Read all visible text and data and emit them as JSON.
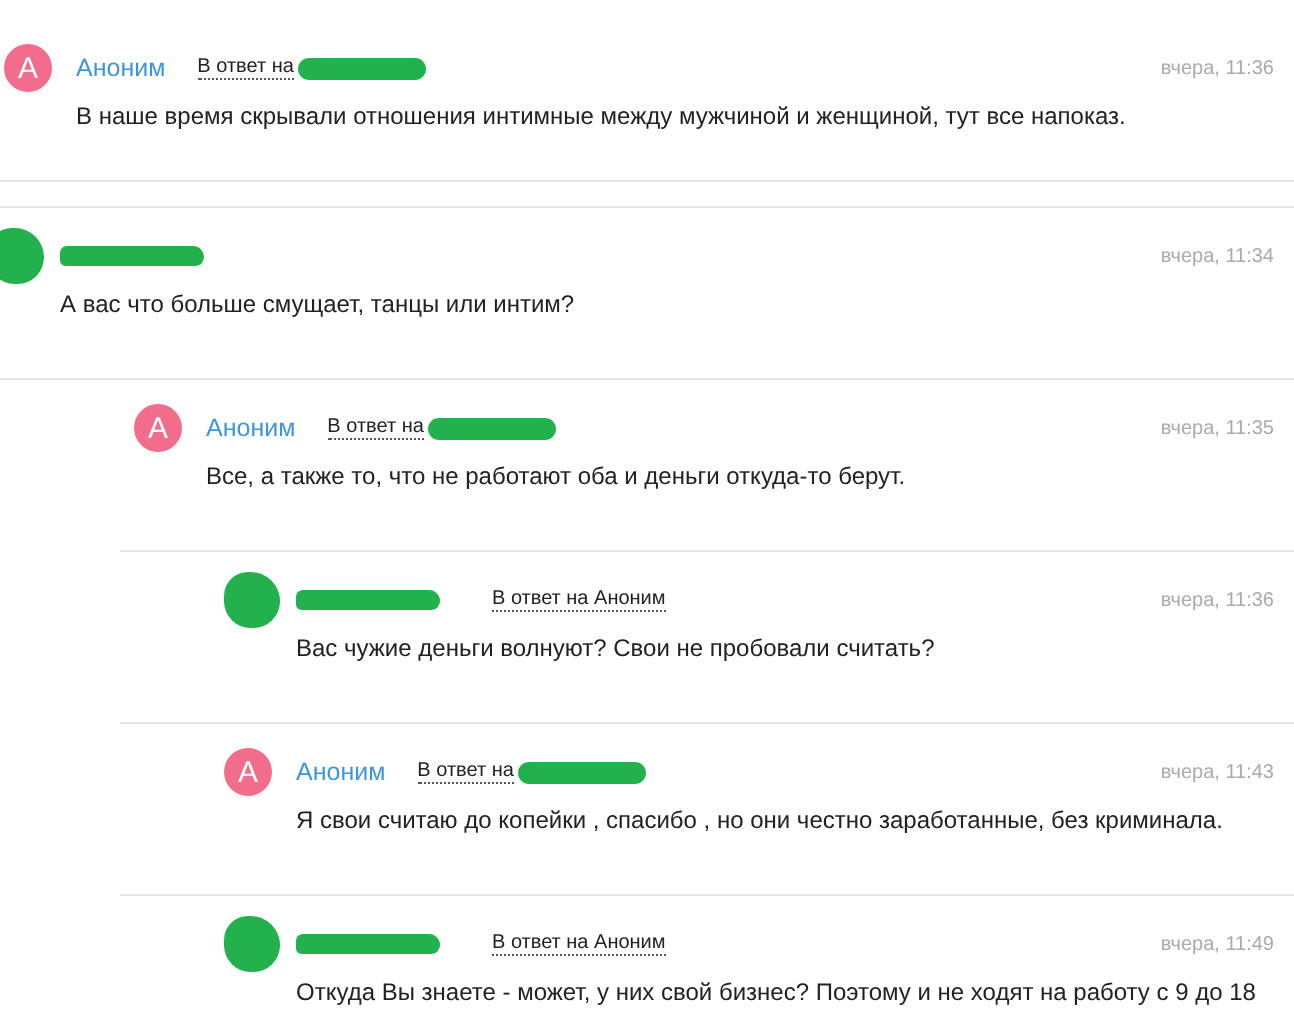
{
  "comments": [
    {
      "author": {
        "redacted": false,
        "name": "Аноним",
        "avatar_letter": "А"
      },
      "reply_to": {
        "label": "В ответ на",
        "redacted": true
      },
      "time": "вчера, 11:36",
      "text": "В наше время скрывали отношения интимные между мужчиной и женщиной, тут все напоказ."
    },
    {
      "author": {
        "redacted": true
      },
      "time": "вчера, 11:34",
      "text": "А вас что больше смущает, танцы или интим?",
      "children": [
        {
          "author": {
            "redacted": false,
            "name": "Аноним",
            "avatar_letter": "А"
          },
          "reply_to": {
            "label": "В ответ на",
            "redacted": true
          },
          "time": "вчера, 11:35",
          "text": "Все, а также то, что не работают оба и деньги откуда-то берут.",
          "children": [
            {
              "author": {
                "redacted": true
              },
              "reply_to": {
                "label": "В ответ на Аноним",
                "redacted": false
              },
              "time": "вчера, 11:36",
              "text": "Вас чужие деньги волнуют? Свои не пробовали считать?"
            },
            {
              "author": {
                "redacted": false,
                "name": "Аноним",
                "avatar_letter": "А"
              },
              "reply_to": {
                "label": "В ответ на",
                "redacted": true
              },
              "time": "вчера, 11:43",
              "text": "Я свои считаю до копейки , спасибо , но они честно заработанные, без криминала."
            },
            {
              "author": {
                "redacted": true
              },
              "reply_to": {
                "label": "В ответ на Аноним",
                "redacted": false
              },
              "time": "вчера, 11:49",
              "text": "Откуда Вы знаете - может, у них свой бизнес? Поэтому и не ходят на работу с 9 до 18"
            }
          ]
        }
      ]
    }
  ]
}
